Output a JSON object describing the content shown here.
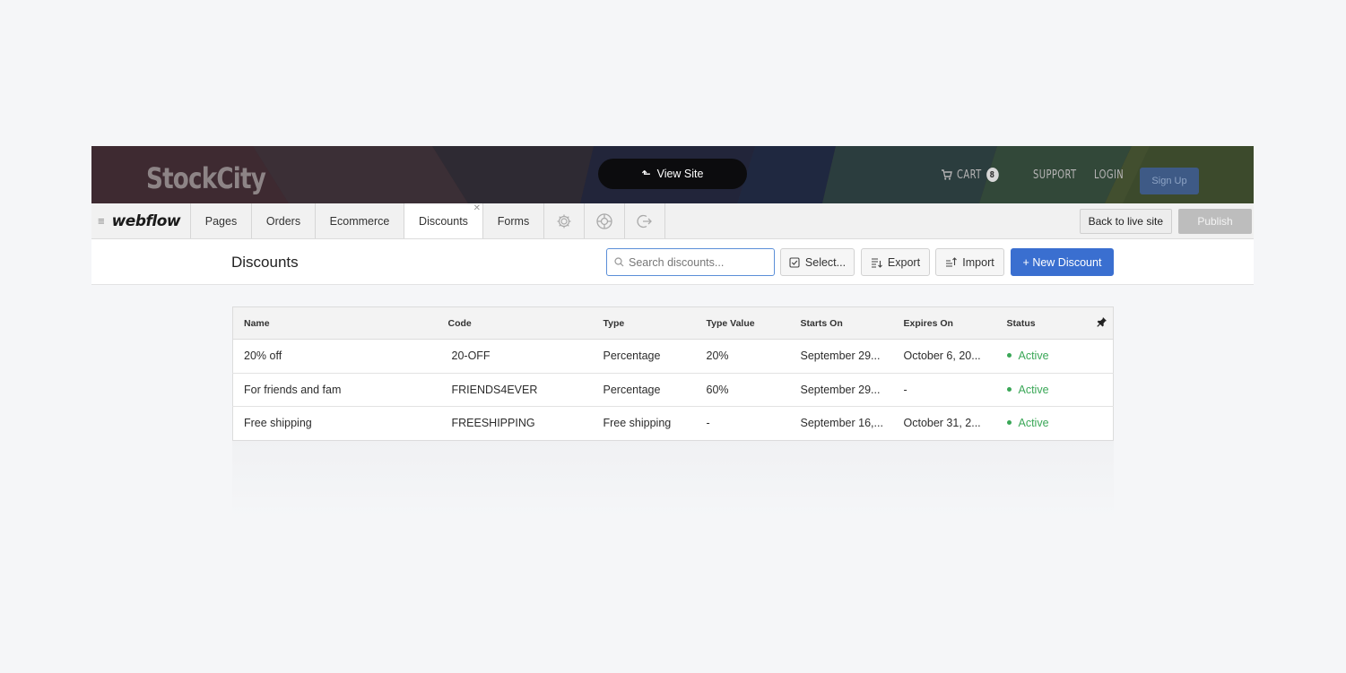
{
  "site": {
    "brand": "StockCity",
    "view_site": "View Site",
    "cart_label": "CART",
    "cart_count": "8",
    "support": "SUPPORT",
    "login": "LOGIN",
    "signup": "Sign Up"
  },
  "editor": {
    "logo": "webflow",
    "tabs": [
      "Pages",
      "Orders",
      "Ecommerce",
      "Discounts",
      "Forms"
    ],
    "active_tab": "Discounts",
    "icon_tabs": [
      "gear-icon",
      "lifebuoy-icon",
      "logout-icon"
    ],
    "back_to_live": "Back to live site",
    "publish": "Publish"
  },
  "toolbar": {
    "title": "Discounts",
    "search_placeholder": "Search discounts...",
    "select": "Select...",
    "export": "Export",
    "import": "Import",
    "new_discount": "+ New Discount"
  },
  "table": {
    "columns": [
      "Name",
      "Code",
      "Type",
      "Type Value",
      "Starts On",
      "Expires On",
      "Status"
    ],
    "rows": [
      {
        "name": "20% off",
        "code": "20-OFF",
        "type": "Percentage",
        "type_value": "20%",
        "starts_on": "September 29...",
        "expires_on": "October 6, 20...",
        "status": "Active"
      },
      {
        "name": "For friends and fam",
        "code": "FRIENDS4EVER",
        "type": "Percentage",
        "type_value": "60%",
        "starts_on": "September 29...",
        "expires_on": "-",
        "status": "Active"
      },
      {
        "name": "Free shipping",
        "code": "FREESHIPPING",
        "type": "Free shipping",
        "type_value": "-",
        "starts_on": "September 16,...",
        "expires_on": "October 31, 2...",
        "status": "Active"
      }
    ]
  },
  "colors": {
    "primary": "#3a6fd0",
    "active_status": "#3aa757",
    "search_focus": "#5b8fd8"
  }
}
